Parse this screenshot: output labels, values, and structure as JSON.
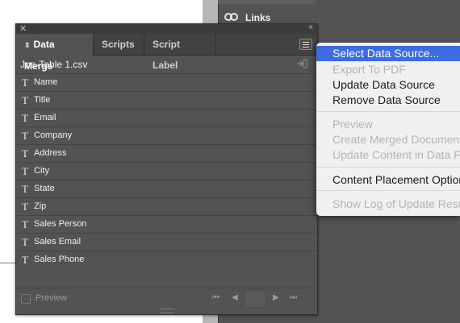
{
  "links_panel": {
    "label": "Links"
  },
  "panel": {
    "tabs": [
      {
        "label": "Data Merge",
        "active": true
      },
      {
        "label": "Scripts"
      },
      {
        "label": "Script Label"
      }
    ],
    "source_file": "Joe-Table 1.csv",
    "fields": [
      "Name",
      "Title",
      "Email",
      "Company",
      "Address",
      "City",
      "State",
      "Zip",
      "Sales Person",
      "Sales Email",
      "Sales Phone"
    ],
    "field_type_glyph": "T",
    "preview_label": "Preview",
    "nav": {
      "first": "⏮",
      "prev": "◀",
      "next": "▶",
      "last": "⏭"
    }
  },
  "flyout_menu": {
    "items": [
      {
        "label": "Select Data Source...",
        "state": "highlighted"
      },
      {
        "label": "Export To PDF",
        "state": "disabled"
      },
      {
        "label": "Update Data Source",
        "state": "enabled"
      },
      {
        "label": "Remove Data Source",
        "state": "enabled"
      },
      {
        "label": "Preview",
        "state": "disabled"
      },
      {
        "label": "Create Merged Document...",
        "state": "disabled"
      },
      {
        "label": "Update Content in Data Fields",
        "state": "disabled"
      },
      {
        "label": "Content Placement Options...",
        "state": "enabled"
      },
      {
        "label": "Show Log of Update Results",
        "state": "disabled"
      }
    ],
    "colors": {
      "highlight": "#3d6ce0",
      "disabled": "#b4b4b4"
    }
  }
}
